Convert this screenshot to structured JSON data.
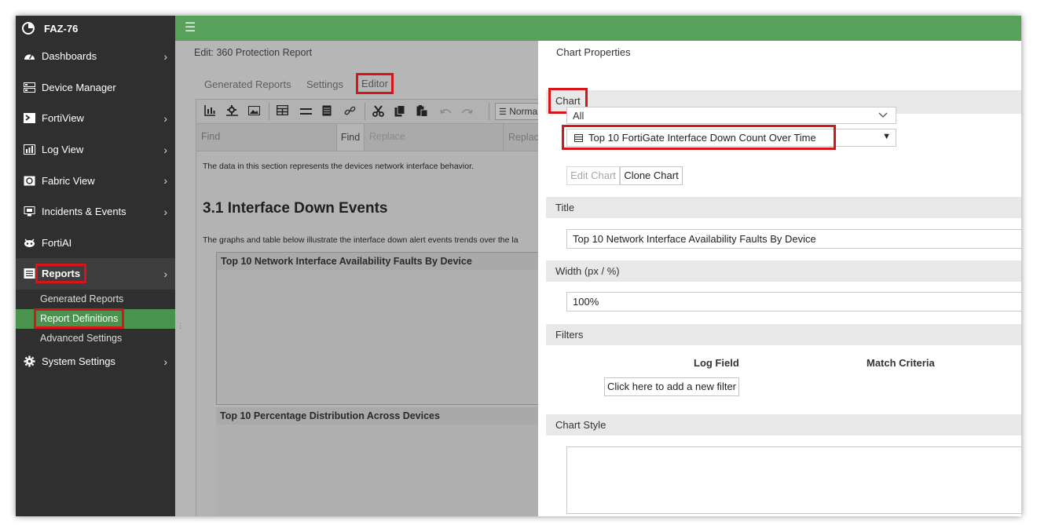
{
  "sidebar": {
    "brand": "FAZ-76",
    "items": [
      {
        "label": "Dashboards",
        "icon": "dashboard-icon",
        "chevron": true
      },
      {
        "label": "Device Manager",
        "icon": "device-manager-icon",
        "chevron": false
      },
      {
        "label": "FortiView",
        "icon": "fortiview-icon",
        "chevron": true
      },
      {
        "label": "Log View",
        "icon": "log-view-icon",
        "chevron": true
      },
      {
        "label": "Fabric View",
        "icon": "fabric-view-icon",
        "chevron": true
      },
      {
        "label": "Incidents & Events",
        "icon": "incidents-icon",
        "chevron": true
      },
      {
        "label": "FortiAI",
        "icon": "fortiai-icon",
        "chevron": false
      },
      {
        "label": "Reports",
        "icon": "reports-icon",
        "chevron": true
      },
      {
        "label": "System Settings",
        "icon": "gear-icon",
        "chevron": true
      }
    ],
    "sub_items": [
      "Generated Reports",
      "Report Definitions",
      "Advanced Settings"
    ],
    "chevron_glyph": "›"
  },
  "editor": {
    "title": "Edit: 360 Protection Report",
    "tabs": [
      "Generated Reports",
      "Settings",
      "Editor"
    ],
    "toolbar_format": "Norma",
    "find_placeholder": "Find",
    "find_button": "Find",
    "replace_placeholder": "Replace",
    "replace_button": "Replac",
    "doc_para1": "The data in this section represents the devices network interface behavior.",
    "doc_heading": "3.1 Interface Down Events",
    "doc_para2": "The graphs and table below illustrate the interface down alert events trends over the la",
    "chart1_title": "Top 10 Network Interface Availability Faults By Device",
    "chart2_title": "Top 10 Percentage Distribution Across Devices"
  },
  "props": {
    "title": "Chart Properties",
    "chart_section": "Chart",
    "category_select": "All",
    "chart_select": "Top 10 FortiGate Interface Down Count Over Time",
    "edit_chart": "Edit Chart",
    "clone_chart": "Clone Chart",
    "title_section": "Title",
    "title_value": "Top 10 Network Interface Availability Faults By Device",
    "width_section": "Width (px / %)",
    "width_value": "100%",
    "filters_section": "Filters",
    "log_field_header": "Log Field",
    "match_criteria_header": "Match Criteria",
    "add_filter": "Click here to add a new filter",
    "chart_style_section": "Chart Style"
  },
  "colors": {
    "topbar": "#58a15b",
    "sidebar": "#2f2f2f",
    "selected_sub": "#4a934e",
    "highlight_box": "#d7141a"
  }
}
